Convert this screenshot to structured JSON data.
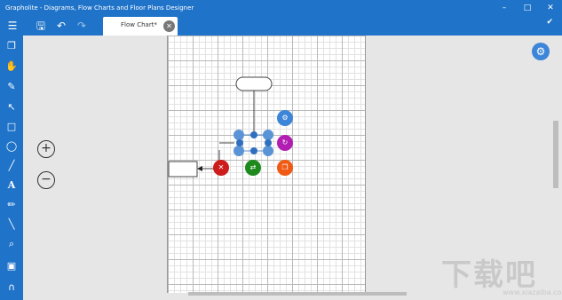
{
  "window": {
    "title": "Grapholite - Diagrams, Flow Charts and Floor Plans Designer",
    "minimize": "–",
    "maximize": "□",
    "close": "✕"
  },
  "toolbar": {
    "menu_icon": "hamburger-icon",
    "save_icon": "save-icon",
    "undo_icon": "undo-icon",
    "redo_icon": "redo-icon"
  },
  "tab": {
    "label": "Flow Chart*",
    "close": "✕"
  },
  "left_tools": [
    {
      "name": "new-page-icon",
      "glyph": "❐"
    },
    {
      "name": "hand-icon",
      "glyph": "✋"
    },
    {
      "name": "pen-icon",
      "glyph": "✎"
    },
    {
      "name": "pointer-icon",
      "glyph": "↖"
    },
    {
      "name": "rectangle-icon",
      "glyph": "□"
    },
    {
      "name": "ellipse-icon",
      "glyph": "◯"
    },
    {
      "name": "line-icon",
      "glyph": "╱"
    },
    {
      "name": "text-icon",
      "glyph": "A"
    },
    {
      "name": "pencil-icon",
      "glyph": "✏"
    },
    {
      "name": "connector-icon",
      "glyph": "╲"
    },
    {
      "name": "zoom-icon",
      "glyph": "⌕"
    },
    {
      "name": "image-icon",
      "glyph": "▣"
    },
    {
      "name": "magnet-icon",
      "glyph": "∩"
    }
  ],
  "zoom": {
    "in": "+",
    "out": "−"
  },
  "actions": {
    "settings_icon": "⚙",
    "delete_icon": "✕",
    "swap_icon": "⇄",
    "copy_icon": "❐",
    "rotate_icon": "↻",
    "gear_icon": "⚙"
  },
  "colors": {
    "accent": "#1f73c8",
    "delete": "#cc1c1c",
    "swap": "#1e8a1e",
    "copy": "#f05a14",
    "rotate": "#b21eb2",
    "gear": "#3d85d8"
  },
  "watermark": {
    "text": "下载吧",
    "sub": "www.xiazaiba.com"
  }
}
